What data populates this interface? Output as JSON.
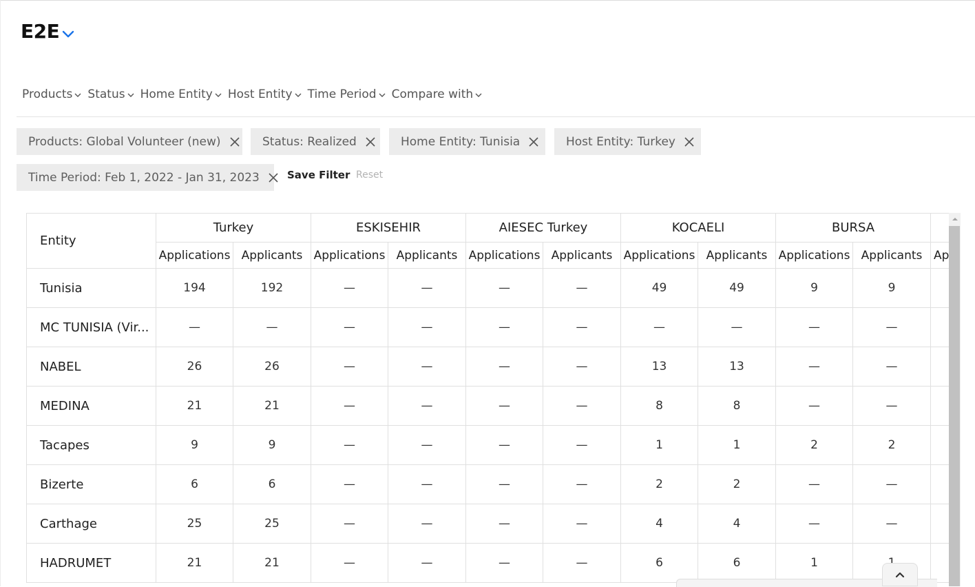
{
  "app": {
    "title": "E2E"
  },
  "filter_menu": [
    {
      "label": "Products"
    },
    {
      "label": "Status"
    },
    {
      "label": "Home Entity"
    },
    {
      "label": "Host Entity"
    },
    {
      "label": "Time Period"
    },
    {
      "label": "Compare with"
    }
  ],
  "active_filters": [
    {
      "label": "Products: Global Volunteer (new)"
    },
    {
      "label": "Status: Realized"
    },
    {
      "label": "Home Entity: Tunisia"
    },
    {
      "label": "Host Entity: Turkey"
    },
    {
      "label": "Time Period: Feb 1, 2022 - Jan 31, 2023"
    }
  ],
  "actions": {
    "save_filter": "Save Filter",
    "reset": "Reset"
  },
  "table": {
    "entity_header": "Entity",
    "groups": [
      "Turkey",
      "ESKISEHIR",
      "AIESEC Turkey",
      "KOCAELI",
      "BURSA"
    ],
    "subheaders": [
      "Applications",
      "Applicants"
    ],
    "partial_subheader": "Ap",
    "rows": [
      {
        "entity": "Tunisia",
        "values": [
          "194",
          "192",
          "—",
          "—",
          "—",
          "—",
          "49",
          "49",
          "9",
          "9"
        ]
      },
      {
        "entity": "MC TUNISIA (Vir...",
        "values": [
          "—",
          "—",
          "—",
          "—",
          "—",
          "—",
          "—",
          "—",
          "—",
          "—"
        ]
      },
      {
        "entity": "NABEL",
        "values": [
          "26",
          "26",
          "—",
          "—",
          "—",
          "—",
          "13",
          "13",
          "—",
          "—"
        ]
      },
      {
        "entity": "MEDINA",
        "values": [
          "21",
          "21",
          "—",
          "—",
          "—",
          "—",
          "8",
          "8",
          "—",
          "—"
        ]
      },
      {
        "entity": "Tacapes",
        "values": [
          "9",
          "9",
          "—",
          "—",
          "—",
          "—",
          "1",
          "1",
          "2",
          "2"
        ]
      },
      {
        "entity": "Bizerte",
        "values": [
          "6",
          "6",
          "—",
          "—",
          "—",
          "—",
          "2",
          "2",
          "—",
          "—"
        ]
      },
      {
        "entity": "Carthage",
        "values": [
          "25",
          "25",
          "—",
          "—",
          "—",
          "—",
          "4",
          "4",
          "—",
          "—"
        ]
      },
      {
        "entity": "HADRUMET",
        "values": [
          "21",
          "21",
          "—",
          "—",
          "—",
          "—",
          "6",
          "6",
          "1",
          "1"
        ]
      }
    ]
  },
  "colors": {
    "accent": "#1a73e8",
    "chip_bg": "#ececec",
    "border": "#e0e0e0"
  },
  "icons": [
    "chevron-down-icon",
    "close-icon",
    "chevron-up-icon"
  ]
}
